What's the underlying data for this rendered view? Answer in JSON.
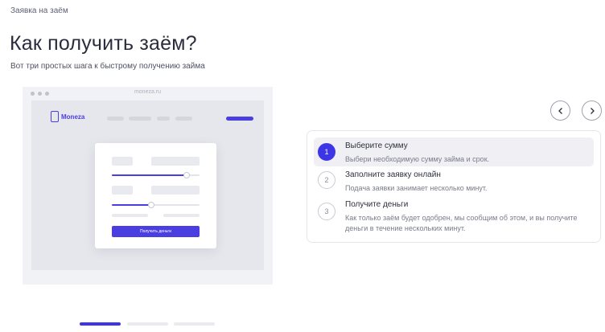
{
  "breadcrumb": "Заявка на заём",
  "title": "Как получить заём?",
  "subtitle": "Вот три простых шага к быстрому получению займа",
  "mockup": {
    "url": "moneza.ru",
    "logo": "Moneza",
    "button_label": "Получить деньги",
    "slider_levels": [
      0.85,
      0.45
    ]
  },
  "steps": [
    {
      "number": "1",
      "title": "Выберите сумму",
      "description": "Выбери необходимую сумму займа и срок.",
      "active": true
    },
    {
      "number": "2",
      "title": "Заполните заявку онлайн",
      "description": "Подача заявки занимает несколько минут.",
      "active": false
    },
    {
      "number": "3",
      "title": "Получите деньги",
      "description": "Как только заём будет одобрен, мы сообщим об этом, и вы получите деньги в течение нескольких минут.",
      "active": false
    }
  ],
  "pagination": {
    "count": 3,
    "active": 1
  },
  "colors": {
    "accent": "#3d36e6",
    "brand": "#4b3ee0"
  },
  "icons": {
    "prev": "chevron-left-icon",
    "next": "chevron-right-icon"
  }
}
